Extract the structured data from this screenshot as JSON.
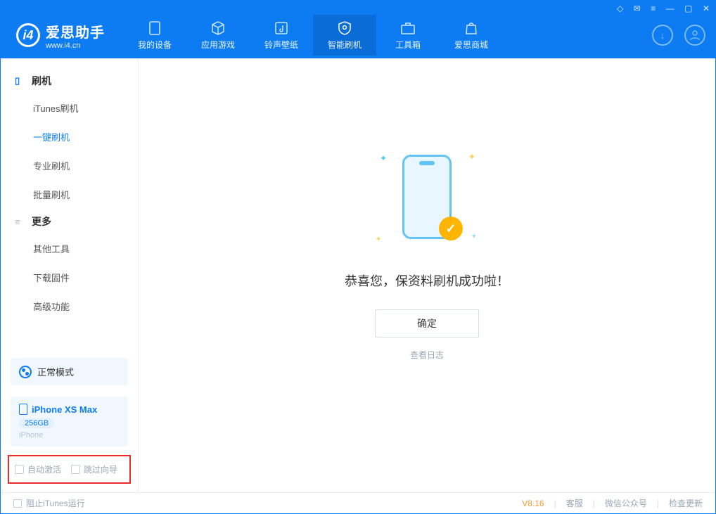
{
  "header": {
    "title": "爱思助手",
    "site": "www.i4.cn",
    "nav": [
      "我的设备",
      "应用游戏",
      "铃声壁纸",
      "智能刷机",
      "工具箱",
      "爱思商城"
    ]
  },
  "sidebar": {
    "groups": [
      {
        "label": "刷机",
        "items": [
          "iTunes刷机",
          "一键刷机",
          "专业刷机",
          "批量刷机"
        ]
      },
      {
        "label": "更多",
        "items": [
          "其他工具",
          "下载固件",
          "高级功能"
        ]
      }
    ],
    "mode": "正常模式",
    "device": {
      "name": "iPhone XS Max",
      "capacity": "256GB",
      "type": "iPhone"
    },
    "options": [
      "自动激活",
      "跳过向导"
    ]
  },
  "main": {
    "message": "恭喜您，保资料刷机成功啦！",
    "confirm": "确定",
    "view_log": "查看日志"
  },
  "footer": {
    "block_itunes": "阻止iTunes运行",
    "version": "V8.16",
    "links": [
      "客服",
      "微信公众号",
      "检查更新"
    ]
  }
}
